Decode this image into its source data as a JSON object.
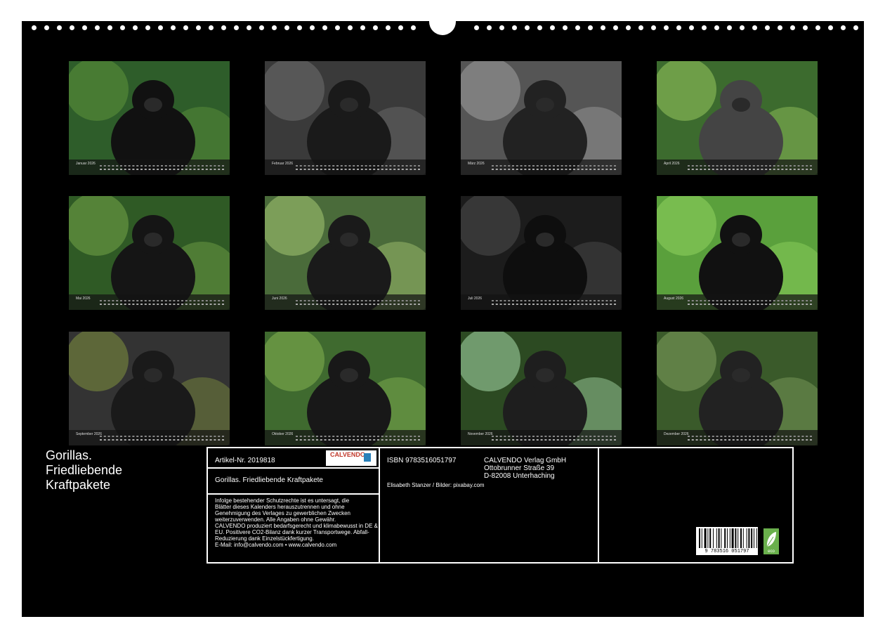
{
  "calendar": {
    "title_lines": [
      "Gorillas.",
      "Friedliebende",
      "Kraftpakete"
    ],
    "months": [
      {
        "label": "Januar 2026"
      },
      {
        "label": "Februar 2026"
      },
      {
        "label": "März 2026"
      },
      {
        "label": "April 2026"
      },
      {
        "label": "Mai 2026"
      },
      {
        "label": "Juni 2026"
      },
      {
        "label": "Juli 2026"
      },
      {
        "label": "August 2026"
      },
      {
        "label": "September 2026"
      },
      {
        "label": "Oktober 2026"
      },
      {
        "label": "November 2026"
      },
      {
        "label": "Dezember 2026"
      }
    ]
  },
  "info": {
    "article": "Artikel-Nr. 2019818",
    "logo_text": "CALVENDO",
    "product_title": "Gorillas. Friedliebende Kraftpakete",
    "legal_lines": [
      "Infolge bestehender Schutzrechte ist es untersagt, die",
      "Blätter dieses Kalenders herauszutrennen und ohne",
      "Genehmigung des Verlages zu gewerblichen Zwecken",
      "weiterzuverwenden. Alle Angaben ohne Gewähr.",
      "CALVENDO produziert bedarfsgerecht und klimabewusst in DE &",
      "EU. Positivere CO2-Bilanz dank kurzer Transportwege. Abfall-",
      "Reduzierung dank Einzelstückfertigung.",
      "E-Mail: info@calvendo.com • www.calvendo.com"
    ],
    "isbn": "ISBN 9783516051797",
    "publisher_lines": [
      "CALVENDO Verlag GmbH",
      "Ottobrunner Straße 39",
      "D-82008 Unterhaching"
    ],
    "credit": "Elisabeth Stanzer / Bilder: pixabay.com",
    "barcode_digits": "9 783516 051797",
    "eco_label": "eco"
  }
}
